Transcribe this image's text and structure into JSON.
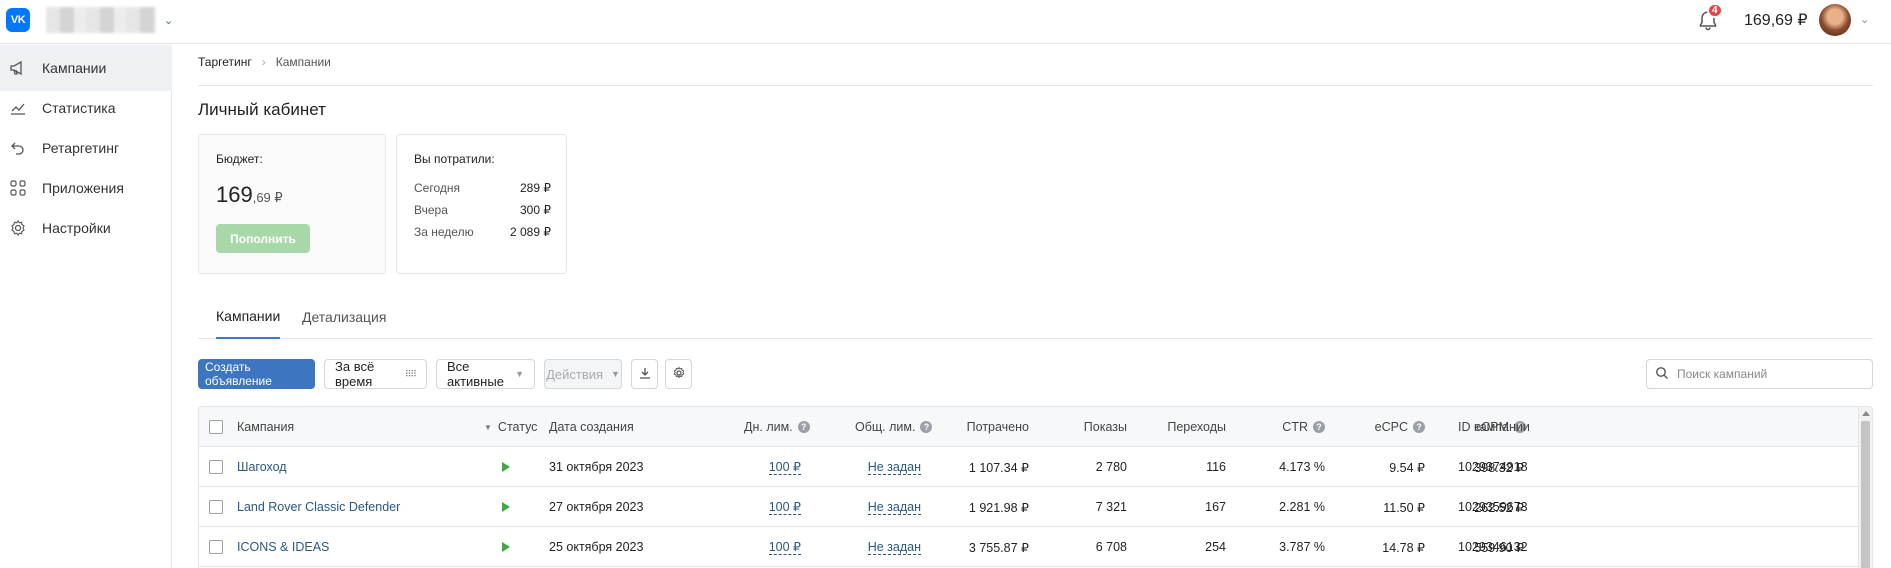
{
  "topbar": {
    "logo_text": "VK",
    "notifications_count": "4",
    "balance": "169,69 ₽",
    "accent_color": "#0077ff"
  },
  "sidebar": {
    "items": [
      {
        "label": "Кампании",
        "icon": "megaphone-icon",
        "active": true
      },
      {
        "label": "Статистика",
        "icon": "trend-chart-icon"
      },
      {
        "label": "Ретаргетинг",
        "icon": "retarget-arrow-icon"
      },
      {
        "label": "Приложения",
        "icon": "apps-grid-icon"
      },
      {
        "label": "Настройки",
        "icon": "gear-icon"
      }
    ]
  },
  "breadcrumb": [
    "Таргетинг",
    "Кампании"
  ],
  "page_title": "Личный кабинет",
  "budget": {
    "label": "Бюджет:",
    "value_main": "169",
    "value_cents": ",69 ₽",
    "topup_label": "Пополнить"
  },
  "spent": {
    "title": "Вы потратили:",
    "rows": [
      {
        "label": "Сегодня",
        "value": "289 ₽"
      },
      {
        "label": "Вчера",
        "value": "300 ₽"
      },
      {
        "label": "За неделю",
        "value": "2 089 ₽"
      }
    ]
  },
  "tabs": [
    {
      "label": "Кампании",
      "active": true
    },
    {
      "label": "Детализация"
    }
  ],
  "toolbar": {
    "create_label": "Создать объявление",
    "period_label": "За всё время",
    "filter_label": "Все активные",
    "actions_label": "Действия",
    "search_placeholder": "Поиск кампаний"
  },
  "table": {
    "columns": [
      "Кампания",
      "Статус",
      "Дата создания",
      "Дн. лим.",
      "Общ. лим.",
      "Потрачено",
      "Показы",
      "Переходы",
      "CTR",
      "eCPC",
      "eCPM",
      "ID кампании"
    ],
    "rows": [
      {
        "name": "Шагоход",
        "status": "running",
        "date": "31 октября 2023",
        "day_limit": "100 ₽",
        "total_limit": "Не задан",
        "spent": "1 107.34 ₽",
        "impressions": "2 780",
        "clicks": "116",
        "ctr": "4.173 %",
        "ecpc": "9.54 ₽",
        "ecpm": "398.32 ₽",
        "id": "1029374918"
      },
      {
        "name": "Land Rover Classic Defender",
        "status": "running",
        "date": "27 октября 2023",
        "day_limit": "100 ₽",
        "total_limit": "Не задан",
        "spent": "1 921.98 ₽",
        "impressions": "7 321",
        "clicks": "167",
        "ctr": "2.281 %",
        "ecpc": "11.50 ₽",
        "ecpm": "262.52 ₽",
        "id": "1029359673"
      },
      {
        "name": "ICONS & IDEAS",
        "status": "running",
        "date": "25 октября 2023",
        "day_limit": "100 ₽",
        "total_limit": "Не задан",
        "spent": "3 755.87 ₽",
        "impressions": "6 708",
        "clicks": "254",
        "ctr": "3.787 %",
        "ecpc": "14.78 ₽",
        "ecpm": "559.90 ₽",
        "id": "1029346132"
      }
    ]
  }
}
